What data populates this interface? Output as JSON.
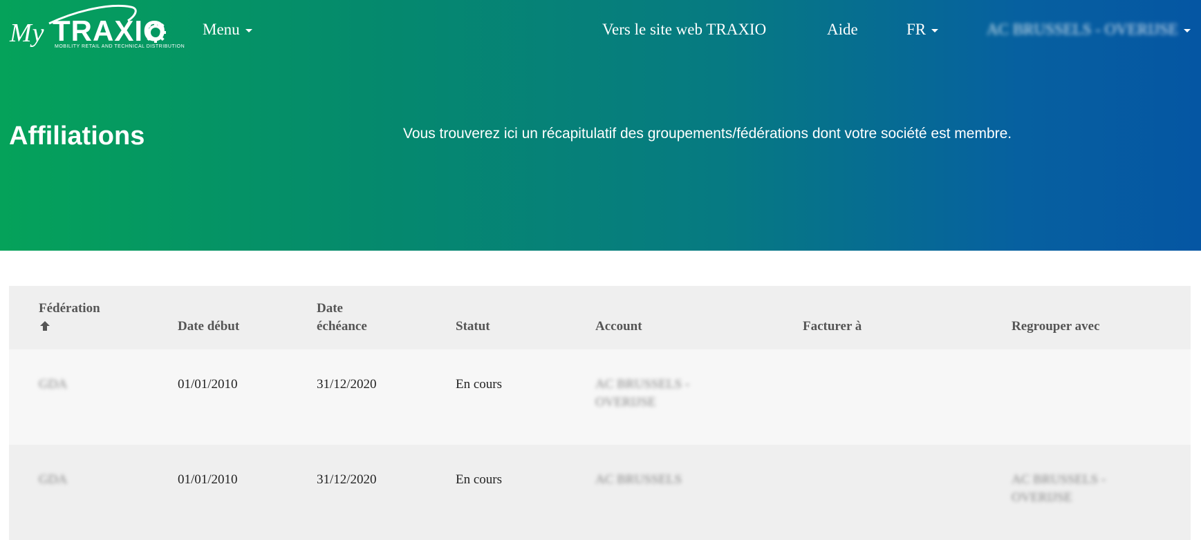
{
  "logo": {
    "prefix": "My",
    "brand": "TRAXIO",
    "tagline": "MOBILITY RETAIL AND TECHNICAL DISTRIBUTION"
  },
  "nav": {
    "menu_label": "Menu",
    "website_link": "Vers le site web TRAXIO",
    "help_link": "Aide",
    "language": "FR",
    "account_name": "AC BRUSSELS - OVERIJSE"
  },
  "header": {
    "title": "Affiliations",
    "description": "Vous trouverez ici un récapitulatif des groupements/fédérations dont votre société est membre."
  },
  "table": {
    "columns": {
      "federation_line1": "Fédération",
      "date_debut": "Date début",
      "date_echeance_line1": "Date",
      "date_echeance_line2": "échéance",
      "statut": "Statut",
      "account": "Account",
      "facturer": "Facturer à",
      "regrouper": "Regrouper avec"
    },
    "sort_icon": "arrow-up-icon",
    "rows": [
      {
        "federation": "GDA",
        "date_debut": "01/01/2010",
        "date_echeance": "31/12/2020",
        "statut": "En cours",
        "account_line1": "AC BRUSSELS -",
        "account_line2": "OVERIJSE",
        "facturer": "",
        "regrouper_line1": "",
        "regrouper_line2": ""
      },
      {
        "federation": "GDA",
        "date_debut": "01/01/2010",
        "date_echeance": "31/12/2020",
        "statut": "En cours",
        "account_line1": "AC BRUSSELS",
        "account_line2": "",
        "facturer": "",
        "regrouper_line1": "AC BRUSSELS -",
        "regrouper_line2": "OVERIJSE"
      }
    ]
  },
  "colors": {
    "gradient_start": "#05a25a",
    "gradient_end": "#0556a3",
    "header_row_bg": "#efefef",
    "row_odd_bg": "#f7f7f7"
  }
}
